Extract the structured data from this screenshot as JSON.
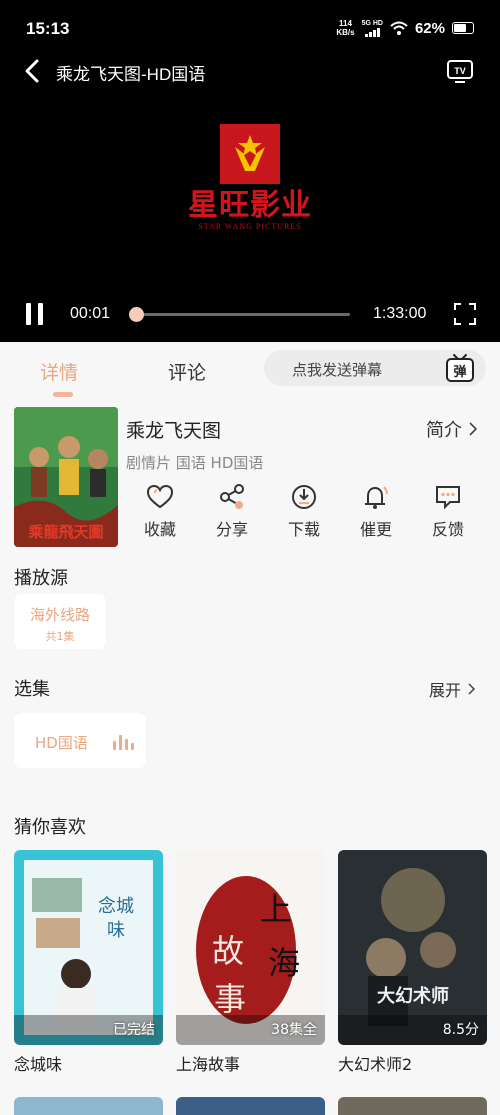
{
  "status": {
    "time": "15:13",
    "net_speed_value": "114",
    "net_speed_unit": "KB/s",
    "signal_label": "5G HD",
    "battery": "62%"
  },
  "player": {
    "title": "乘龙飞天图-HD国语",
    "logo_text": "星旺影业",
    "logo_sub": "STAR WANG PICTURES",
    "current_time": "00:01",
    "total_time": "1:33:00",
    "progress_fraction": 0.0
  },
  "tabs": {
    "detail": "详情",
    "comment": "评论",
    "danmu_placeholder": "点我发送弹幕",
    "danmu_icon_text": "弹"
  },
  "movie": {
    "title": "乘龙飞天图",
    "meta": "剧情片 国语 HD国语",
    "intro_label": "简介"
  },
  "actions": [
    {
      "label": "收藏",
      "icon": "heart-icon"
    },
    {
      "label": "分享",
      "icon": "share-icon"
    },
    {
      "label": "下载",
      "icon": "download-icon"
    },
    {
      "label": "催更",
      "icon": "bell-icon"
    },
    {
      "label": "反馈",
      "icon": "feedback-icon"
    }
  ],
  "source": {
    "section_title": "播放源",
    "name": "海外线路",
    "count": "共1集"
  },
  "episodes": {
    "section_title": "选集",
    "expand_label": "展开",
    "current": "HD国语"
  },
  "recommend": {
    "section_title": "猜你喜欢",
    "items": [
      {
        "name": "念城味",
        "badge": "已完结"
      },
      {
        "name": "上海故事",
        "badge": "38集全"
      },
      {
        "name": "大幻术师2",
        "badge": "8.5分"
      }
    ]
  },
  "colors": {
    "accent": "#e9a782",
    "logo_red": "#c8161d"
  }
}
